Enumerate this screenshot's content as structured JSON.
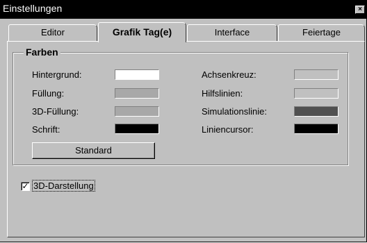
{
  "window": {
    "title": "Einstellungen",
    "close_glyph": "×"
  },
  "tabs": [
    {
      "label": "Editor",
      "active": false
    },
    {
      "label": "Grafik Tag(e)",
      "active": true
    },
    {
      "label": "Interface",
      "active": false
    },
    {
      "label": "Feiertage",
      "active": false
    }
  ],
  "farben": {
    "title": "Farben",
    "left": [
      {
        "label": "Hintergrund:",
        "color": "#ffffff"
      },
      {
        "label": "Füllung:",
        "color": "#a8a8a8"
      },
      {
        "label": "3D-Füllung:",
        "color": "#a8a8a8"
      },
      {
        "label": "Schrift:",
        "color": "#000000"
      }
    ],
    "right": [
      {
        "label": "Achsenkreuz:",
        "color": "#c0c0c0"
      },
      {
        "label": "Hilfslinien:",
        "color": "#c0c0c0"
      },
      {
        "label": "Simulationslinie:",
        "color": "#505050"
      },
      {
        "label": "Liniencursor:",
        "color": "#000000"
      }
    ],
    "standard_button": "Standard"
  },
  "options": {
    "darstellung_3d_label": "3D-Darstellung",
    "darstellung_3d_checked": true,
    "check_glyph": "✓"
  }
}
